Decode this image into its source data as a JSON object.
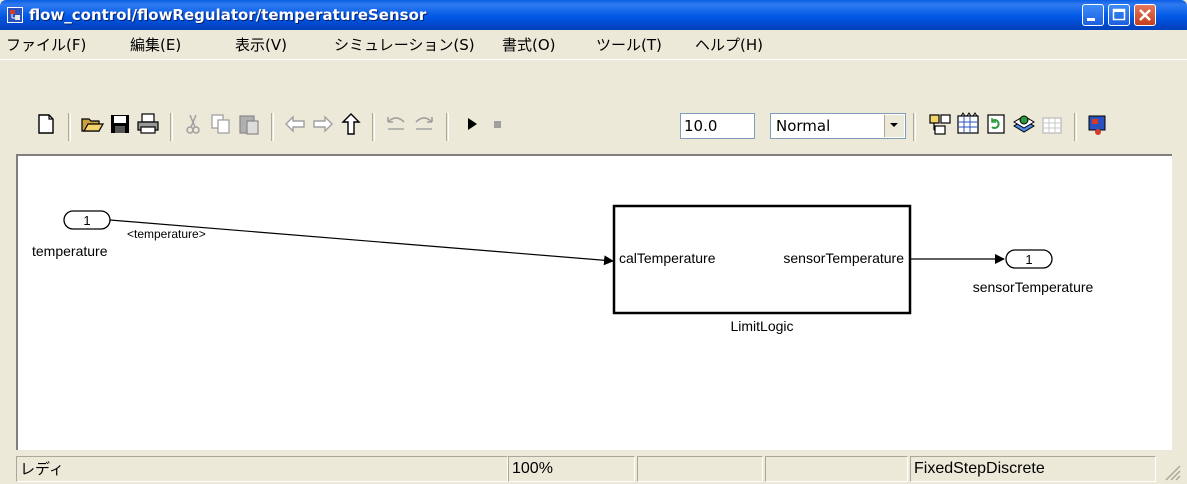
{
  "window": {
    "title": "flow_control/flowRegulator/temperatureSensor"
  },
  "menu": {
    "items": [
      "ファイル(F)",
      "編集(E)",
      "表示(V)",
      "シミュレーション(S)",
      "書式(O)",
      "ツール(T)",
      "ヘルプ(H)"
    ]
  },
  "toolbar": {
    "stop_time": "10.0",
    "sim_mode": "Normal"
  },
  "diagram": {
    "inport": {
      "number": "1",
      "name": "temperature"
    },
    "signal_label": "<temperature>",
    "subsystem": {
      "name": "LimitLogic",
      "input_port": "calTemperature",
      "output_port": "sensorTemperature"
    },
    "outport": {
      "number": "1",
      "name": "sensorTemperature"
    }
  },
  "status": {
    "ready": "レディ",
    "zoom": "100%",
    "field3": "",
    "field4": "",
    "solver": "FixedStepDiscrete"
  }
}
